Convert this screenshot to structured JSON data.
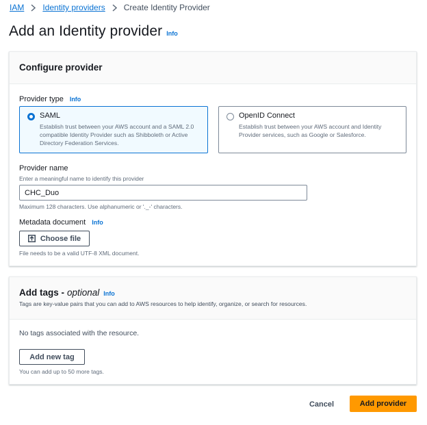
{
  "breadcrumb": {
    "items": [
      {
        "label": "IAM"
      },
      {
        "label": "Identity providers"
      },
      {
        "label": "Create Identity Provider"
      }
    ]
  },
  "page": {
    "title": "Add an Identity provider",
    "info_label": "Info"
  },
  "configure": {
    "title": "Configure provider",
    "provider_type": {
      "label": "Provider type",
      "info_label": "Info",
      "selected": "SAML",
      "options": [
        {
          "title": "SAML",
          "description": "Establish trust between your AWS account and a SAML 2.0 compatible Identity Provider such as Shibboleth or Active Directory Federation Services."
        },
        {
          "title": "OpenID Connect",
          "description": "Establish trust between your AWS account and Identity Provider services, such as Google or Salesforce."
        }
      ]
    },
    "provider_name": {
      "label": "Provider name",
      "description": "Enter a meaningful name to identify this provider",
      "value": "CHC_Duo",
      "constraint": "Maximum 128 characters. Use alphanumeric or '._-' characters."
    },
    "metadata": {
      "label": "Metadata document",
      "info_label": "Info",
      "button_label": "Choose file",
      "button_icon": "upload-icon",
      "constraint": "File needs to be a valid UTF-8 XML document."
    }
  },
  "tags": {
    "title": "Add tags -",
    "optional": "optional",
    "info_label": "Info",
    "description": "Tags are key-value pairs that you can add to AWS resources to help identify, organize, or search for resources.",
    "empty_text": "No tags associated with the resource.",
    "add_button": "Add new tag",
    "limit_text": "You can add up to 50 more tags."
  },
  "actions": {
    "cancel": "Cancel",
    "submit": "Add provider"
  },
  "colors": {
    "link": "#0972d3",
    "primary_button": "#ff9900",
    "selected_tile_bg": "#f1faff"
  }
}
